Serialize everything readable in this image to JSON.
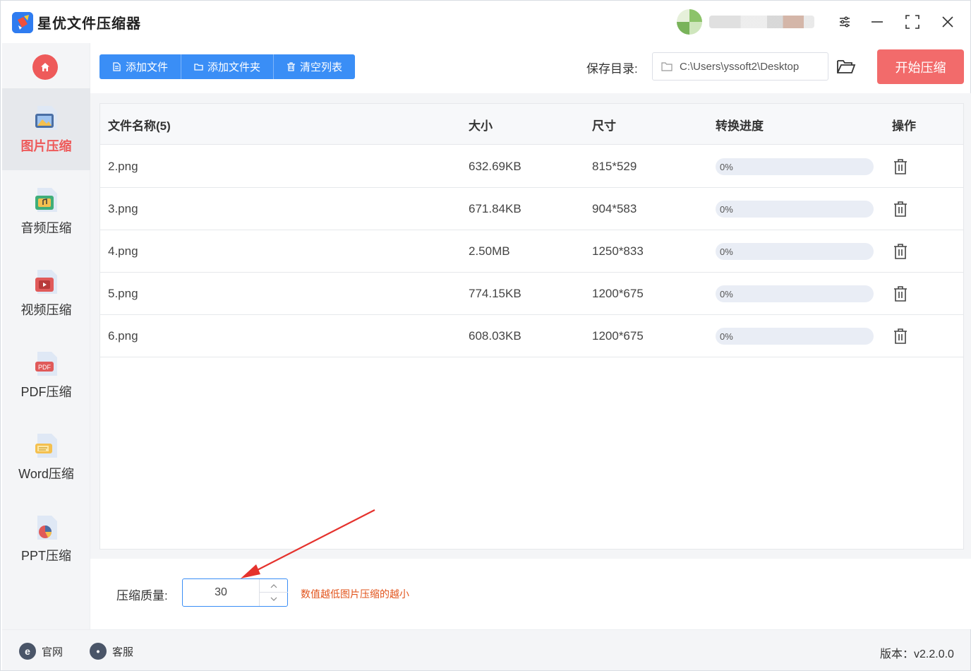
{
  "app": {
    "title": "星优文件压缩器",
    "version_label": "版本：v2.2.0.0"
  },
  "sidebar": {
    "items": [
      {
        "label": "图片压缩",
        "icon": "image-icon",
        "active": true
      },
      {
        "label": "音频压缩",
        "icon": "audio-icon",
        "active": false
      },
      {
        "label": "视频压缩",
        "icon": "video-icon",
        "active": false
      },
      {
        "label": "PDF压缩",
        "icon": "pdf-icon",
        "active": false
      },
      {
        "label": "Word压缩",
        "icon": "word-icon",
        "active": false
      },
      {
        "label": "PPT压缩",
        "icon": "ppt-icon",
        "active": false
      }
    ]
  },
  "toolbar": {
    "add_file": "添加文件",
    "add_folder": "添加文件夹",
    "clear_list": "清空列表",
    "save_dir_label": "保存目录:",
    "save_dir_value": "C:\\Users\\yssoft2\\Desktop",
    "start": "开始压缩"
  },
  "table": {
    "headers": {
      "name": "文件名称(5)",
      "size": "大小",
      "dimensions": "尺寸",
      "progress": "转换进度",
      "action": "操作"
    },
    "rows": [
      {
        "name": "2.png",
        "size": "632.69KB",
        "dimensions": "815*529",
        "progress": "0%"
      },
      {
        "name": "3.png",
        "size": "671.84KB",
        "dimensions": "904*583",
        "progress": "0%"
      },
      {
        "name": "4.png",
        "size": "2.50MB",
        "dimensions": "1250*833",
        "progress": "0%"
      },
      {
        "name": "5.png",
        "size": "774.15KB",
        "dimensions": "1200*675",
        "progress": "0%"
      },
      {
        "name": "6.png",
        "size": "608.03KB",
        "dimensions": "1200*675",
        "progress": "0%"
      }
    ]
  },
  "quality": {
    "label": "压缩质量:",
    "value": "30",
    "hint": "数值越低图片压缩的越小"
  },
  "footer": {
    "website": "官网",
    "support": "客服"
  },
  "colors": {
    "accent_blue": "#3a8ef6",
    "accent_red": "#f26b6b",
    "hint_orange": "#e2541c"
  }
}
